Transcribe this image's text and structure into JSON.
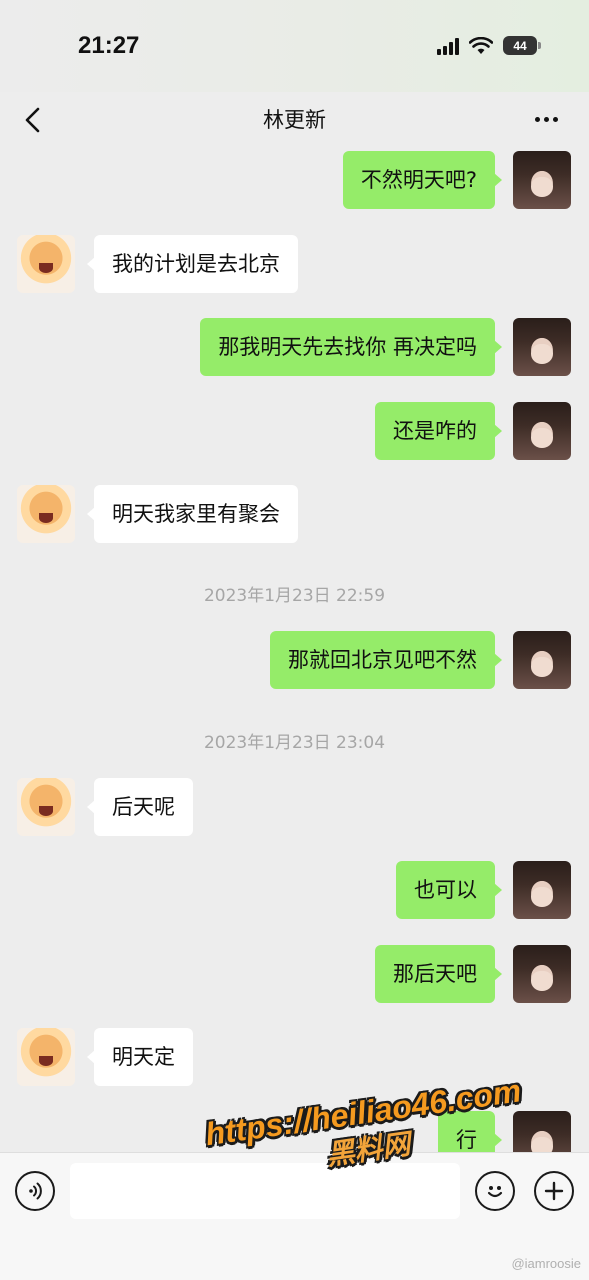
{
  "status_bar": {
    "time": "21:27",
    "battery": "44"
  },
  "nav": {
    "title": "林更新"
  },
  "messages": [
    {
      "side": "me",
      "text": "不然明天吧?"
    },
    {
      "side": "other",
      "text": "我的计划是去北京"
    },
    {
      "side": "me",
      "text": "那我明天先去找你 再决定吗"
    },
    {
      "side": "me",
      "text": "还是咋的"
    },
    {
      "side": "other",
      "text": "明天我家里有聚会"
    },
    {
      "side": "time",
      "text": "2023年1月23日 22:59"
    },
    {
      "side": "me",
      "text": "那就回北京见吧不然"
    },
    {
      "side": "time",
      "text": "2023年1月23日 23:04"
    },
    {
      "side": "other",
      "text": "后天呢"
    },
    {
      "side": "me",
      "text": "也可以"
    },
    {
      "side": "me",
      "text": "那后天吧"
    },
    {
      "side": "other",
      "text": "明天定"
    },
    {
      "side": "me",
      "text": "行"
    }
  ],
  "input": {
    "placeholder": ""
  },
  "watermark": {
    "url": "https://heiliao46.com",
    "name": "黑料网"
  },
  "credit": "@iamroosie",
  "colors": {
    "me_bubble": "#95ec69",
    "other_bubble": "#ffffff",
    "background": "#ededed",
    "watermark": "#f59a1f"
  },
  "icons": [
    "back-icon",
    "more-icon",
    "voice-icon",
    "emoji-icon",
    "plus-icon",
    "signal-icon",
    "wifi-icon",
    "battery-icon"
  ]
}
